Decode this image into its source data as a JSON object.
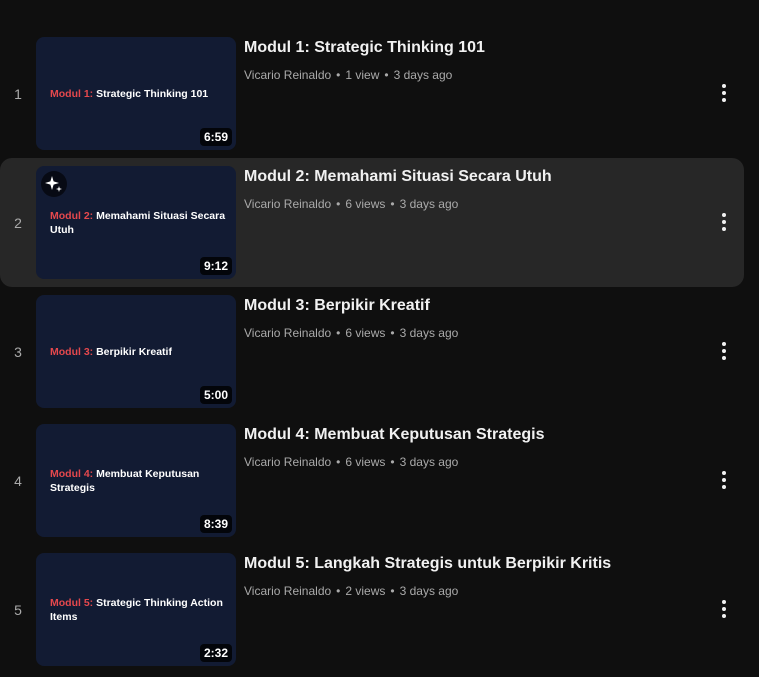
{
  "playlist": {
    "items": [
      {
        "index": "1",
        "thumb_prefix": "Modul 1:",
        "thumb_text": "Strategic Thinking 101",
        "duration": "6:59",
        "title": "Modul 1: Strategic Thinking 101",
        "channel": "Vicario Reinaldo",
        "views": "1 view",
        "age": "3 days ago"
      },
      {
        "index": "2",
        "thumb_prefix": "Modul 2:",
        "thumb_text": "Memahami Situasi Secara Utuh",
        "duration": "9:12",
        "title": "Modul 2: Memahami Situasi Secara Utuh",
        "channel": "Vicario Reinaldo",
        "views": "6 views",
        "age": "3 days ago"
      },
      {
        "index": "3",
        "thumb_prefix": "Modul 3:",
        "thumb_text": "Berpikir Kreatif",
        "duration": "5:00",
        "title": "Modul 3: Berpikir Kreatif",
        "channel": "Vicario Reinaldo",
        "views": "6 views",
        "age": "3 days ago"
      },
      {
        "index": "4",
        "thumb_prefix": "Modul 4:",
        "thumb_text": "Membuat Keputusan Strategis",
        "duration": "8:39",
        "title": "Modul 4: Membuat Keputusan Strategis",
        "channel": "Vicario Reinaldo",
        "views": "6 views",
        "age": "3 days ago"
      },
      {
        "index": "5",
        "thumb_prefix": "Modul 5:",
        "thumb_text": "Strategic Thinking Action Items",
        "duration": "2:32",
        "title": "Modul 5: Langkah Strategis untuk Berpikir Kritis",
        "channel": "Vicario Reinaldo",
        "views": "2 views",
        "age": "3 days ago"
      }
    ],
    "meta_separator": "•",
    "menu_icon": "more-vert-icon",
    "sparkle_icon": "sparkle-icon",
    "colors": {
      "background": "#0f0f0f",
      "active_row": "#272727",
      "thumb_bg": "#121b33",
      "thumb_accent": "#e5484d"
    }
  }
}
